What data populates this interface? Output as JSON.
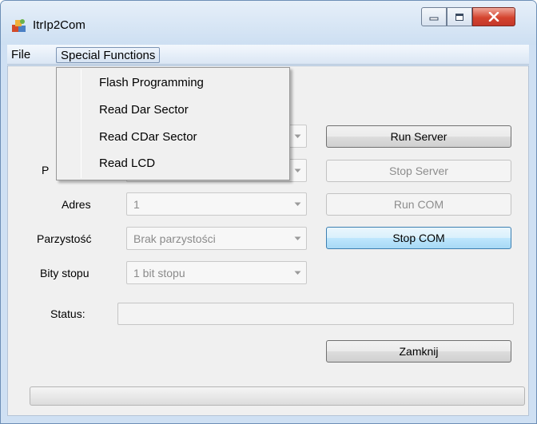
{
  "window": {
    "title": "ItrIp2Com",
    "controls": {
      "minimize_icon": "minimize-icon",
      "maximize_icon": "maximize-icon",
      "close_icon": "close-icon"
    }
  },
  "menu": {
    "file": "File",
    "special": "Special Functions",
    "special_items": [
      "Flash Programming",
      "Read Dar Sector",
      "Read CDar Sector",
      "Read LCD"
    ]
  },
  "form": {
    "port_label_partial": "P",
    "address_label": "Adres",
    "address_value": "1",
    "parity_label": "Parzystość",
    "parity_value": "Brak parzystości",
    "stop_bits_label": "Bity stopu",
    "stop_bits_value": "1 bit stopu",
    "status_label": "Status:",
    "status_value": ""
  },
  "buttons": {
    "run_server": "Run Server",
    "stop_server": "Stop Server",
    "run_com": "Run COM",
    "stop_com": "Stop COM",
    "close": "Zamknij"
  },
  "progress": {
    "value": 0
  },
  "colors": {
    "title_gradient_top": "#e6eff9",
    "close_button": "#d4442f",
    "focus_border": "#3c7fb1",
    "disabled_text": "#8d8d8d"
  }
}
